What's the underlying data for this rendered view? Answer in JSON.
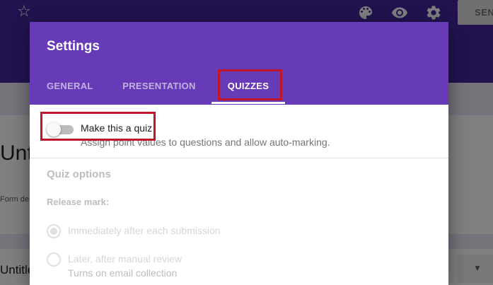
{
  "background": {
    "send_label": "SEND",
    "form_title": "Untitled form",
    "form_description": "Form description",
    "question_title": "Untitled Question",
    "colors": {
      "header": "#4527a0",
      "body": "#ede7f6"
    }
  },
  "icons": {
    "star": "star-icon",
    "palette": "palette-icon",
    "preview": "eye-icon",
    "settings": "gear-icon",
    "dropdown": "chevron-down-icon"
  },
  "dialog": {
    "title": "Settings",
    "tabs": [
      {
        "label": "GENERAL",
        "active": false
      },
      {
        "label": "PRESENTATION",
        "active": false
      },
      {
        "label": "QUIZZES",
        "active": true
      }
    ],
    "quiz_toggle": {
      "label": "Make this a quiz",
      "description": "Assign point values to questions and allow auto-marking.",
      "enabled": false
    },
    "quiz_options": {
      "title": "Quiz options",
      "release_mark_label": "Release mark:",
      "options": [
        {
          "label": "Immediately after each submission",
          "sublabel": "",
          "selected": true
        },
        {
          "label": "Later, after manual review",
          "sublabel": "Turns on email collection",
          "selected": false
        }
      ]
    },
    "colors": {
      "header": "#673ab7",
      "highlight": "#c0152a"
    }
  }
}
